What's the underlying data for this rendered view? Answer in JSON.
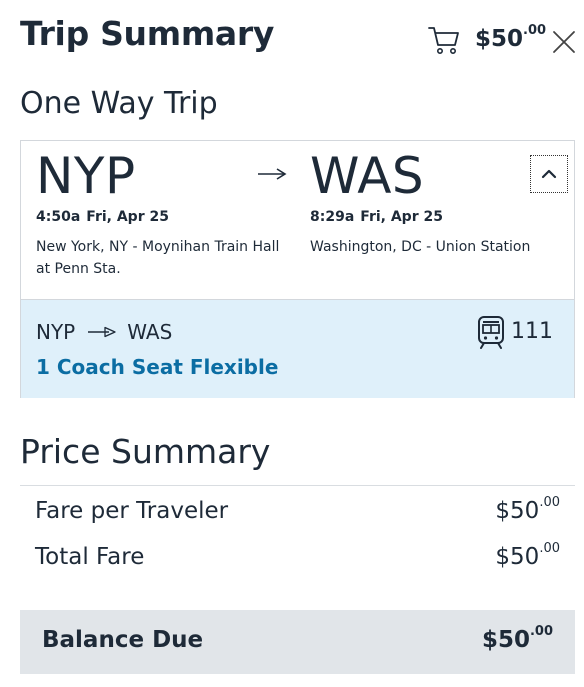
{
  "header": {
    "title": "Trip Summary",
    "cart_icon": "cart-icon",
    "cart_total_dollars": "$50",
    "cart_total_cents": ".00",
    "close_icon": "close-icon"
  },
  "trip": {
    "section_title": "One Way Trip",
    "origin": {
      "code": "NYP",
      "time": "4:50a",
      "date": "Fri, Apr 25",
      "station": "New York, NY - Moynihan Train Hall at Penn Sta."
    },
    "destination": {
      "code": "WAS",
      "time": "8:29a",
      "date": "Fri, Apr 25",
      "station": "Washington, DC - Union Station"
    },
    "arrow_icon": "arrow-right-icon",
    "collapse_icon": "chevron-up-icon",
    "segment": {
      "origin": "NYP",
      "destination": "WAS",
      "fare": "1 Coach Seat Flexible",
      "train_icon": "train-icon",
      "train_number": "111"
    }
  },
  "price_summary": {
    "title": "Price Summary",
    "rows": [
      {
        "label": "Fare per Traveler",
        "dollars": "$50",
        "cents": ".00"
      },
      {
        "label": "Total Fare",
        "dollars": "$50",
        "cents": ".00"
      }
    ],
    "balance": {
      "label": "Balance Due",
      "dollars": "$50",
      "cents": ".00"
    }
  },
  "colors": {
    "text": "#1e2a38",
    "accent_link": "#0b6da3",
    "segment_bg": "#dff0fa",
    "balance_bg": "#e1e5e9"
  }
}
